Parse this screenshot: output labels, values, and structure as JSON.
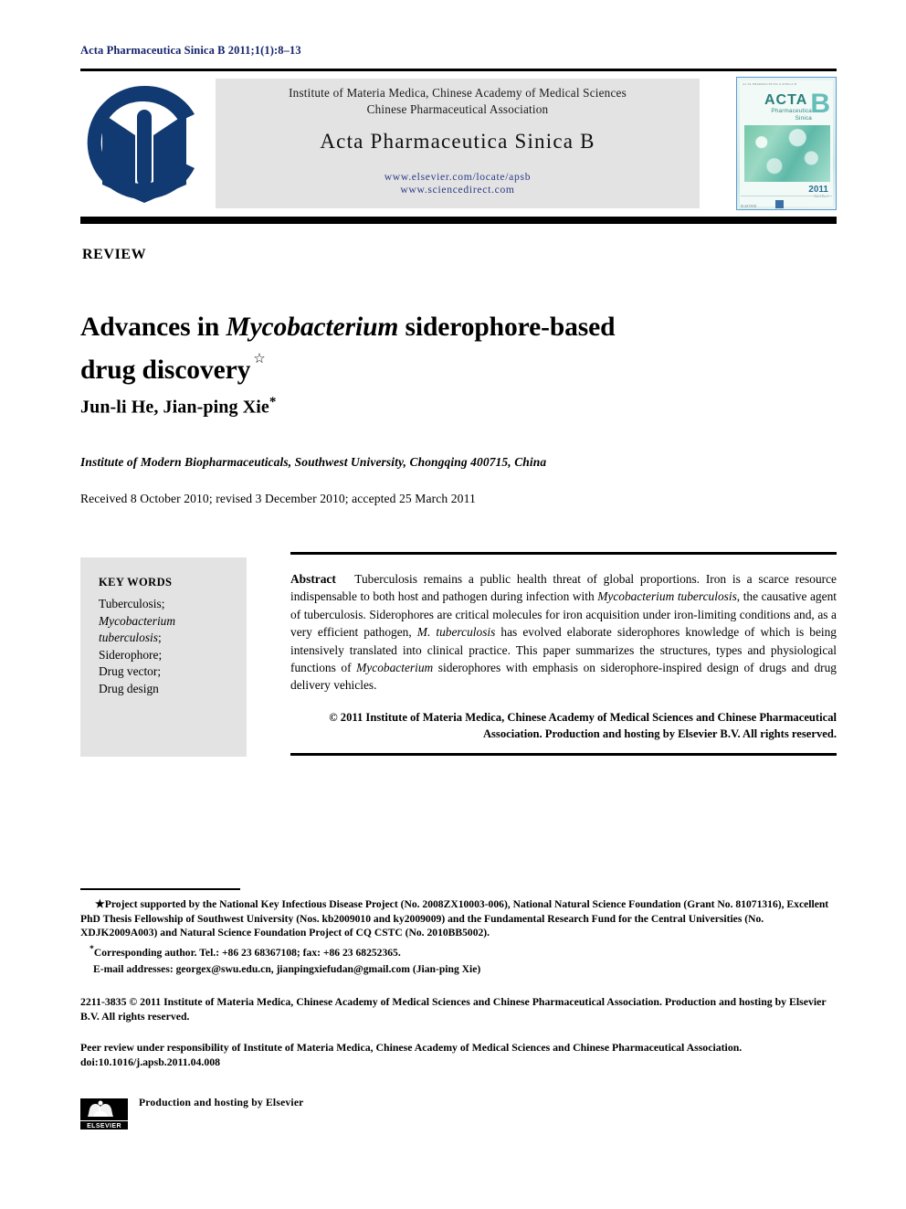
{
  "running_head": "Acta Pharmaceutica Sinica B 2011;1(1):8–13",
  "header": {
    "org_line1": "Institute of Materia Medica, Chinese Academy of Medical Sciences",
    "org_line2": "Chinese Pharmaceutical Association",
    "journal_title": "Acta Pharmaceutica Sinica B",
    "url_elsevier": "www.elsevier.com/locate/apsb",
    "url_sciencedirect": "www.sciencedirect.com",
    "link_color": "#2b3a86",
    "band_bg": "#e3e3e3"
  },
  "cover": {
    "top_note": "ACTA PHARMACEUTICA SINICA B",
    "acta": "ACTA",
    "b": "B",
    "sub1": "Pharmaceutica",
    "sub2": "Sinica",
    "year": "2011",
    "issue": "Vol.1   No.1",
    "elsevier": "ELSEVIER"
  },
  "article": {
    "type": "REVIEW",
    "title_part1": "Advances in ",
    "title_italic": "Mycobacterium",
    "title_part2": " siderophore-based",
    "title_line2": "drug discovery",
    "title_footnote_marker": "☆",
    "authors": "Jun-li He, Jian-ping Xie",
    "author_marker": "*",
    "affiliation": "Institute of Modern Biopharmaceuticals, Southwest University, Chongqing 400715, China",
    "history": "Received 8 October 2010; revised 3 December 2010; accepted 25 March 2011"
  },
  "keywords": {
    "heading": "KEY WORDS",
    "items": [
      {
        "text": "Tuberculosis;",
        "italic": false
      },
      {
        "text": "Mycobacterium",
        "italic": true
      },
      {
        "text": "tuberculosis",
        "italic": true,
        "suffix": ";"
      },
      {
        "text": "Siderophore;",
        "italic": false
      },
      {
        "text": "Drug vector;",
        "italic": false
      },
      {
        "text": "Drug design",
        "italic": false
      }
    ]
  },
  "abstract": {
    "label": "Abstract",
    "s1": "Tuberculosis remains a public health threat of global proportions. Iron is a scarce resource indispensable to both host and pathogen during infection with ",
    "i1": "Mycobacterium tuberculosis",
    "s2": ", the causative agent of tuberculosis. Siderophores are critical molecules for iron acquisition under iron-limiting conditions and, as a very efficient pathogen, ",
    "i2": "M. tuberculosis",
    "s3": " has evolved elaborate siderophores knowledge of which is being intensively translated into clinical practice. This paper summarizes the structures, types and physiological functions of ",
    "i3": "Mycobacterium",
    "s4": " siderophores with emphasis on siderophore-inspired design of drugs and drug delivery vehicles.",
    "copyright": "© 2011 Institute of Materia Medica, Chinese Academy of Medical Sciences and Chinese Pharmaceutical Association. Production and hosting by Elsevier B.V. All rights reserved."
  },
  "footnotes": {
    "project_marker": "★",
    "project": "Project supported by the National Key Infectious Disease Project (No. 2008ZX10003-006), National Natural Science Foundation (Grant No. 81071316), Excellent PhD Thesis Fellowship of Southwest University (Nos. kb2009010 and ky2009009) and the Fundamental Research Fund for the Central Universities (No. XDJK2009A003) and Natural Science Foundation Project of CQ CSTC (No. 2010BB5002).",
    "corresponding_marker": "*",
    "corresponding": "Corresponding author. Tel.: +86 23 68367108; fax: +86 23 68252365.",
    "email": "E-mail addresses: georgex@swu.edu.cn, jianpingxiefudan@gmail.com (Jian-ping Xie)"
  },
  "legal": {
    "issn_line": "2211-3835 © 2011 Institute of Materia Medica, Chinese Academy of Medical Sciences and Chinese Pharmaceutical Association. Production and hosting by Elsevier B.V. All rights reserved.",
    "peer_review": "Peer review under responsibility of Institute of Materia Medica, Chinese Academy of Medical Sciences and Chinese Pharmaceutical Association.",
    "doi": "doi:10.1016/j.apsb.2011.04.008"
  },
  "elsevier_mark": {
    "caption": "Production and hosting by Elsevier",
    "wordmark": "ELSEVIER"
  }
}
